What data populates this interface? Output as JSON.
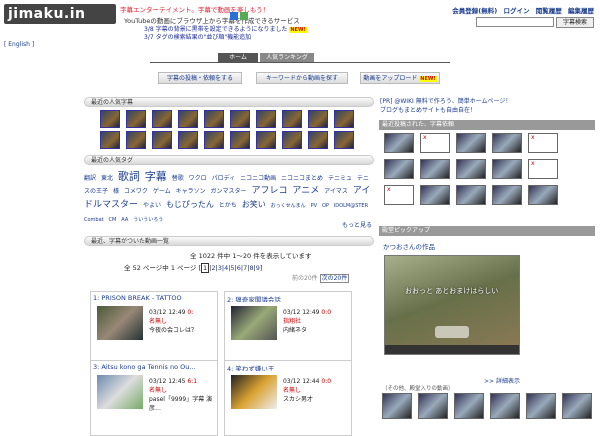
{
  "header": {
    "logo": "jimaku.in",
    "tagline1": "字幕エンターテイメント。字幕で動画を楽しもう！",
    "tagline2": "YouTubeの動画にブラウザ上から字幕を作成できるサービス",
    "news": [
      {
        "text": "3/8 字幕の背景に黒帯を設定できるようになりました",
        "badge": "NEW!"
      },
      {
        "text": "3/7 タグの検索結果の\"並び順\"機能追加",
        "badge": ""
      }
    ],
    "links": [
      "会員登録(無料)",
      "ログイン",
      "閲覧履歴",
      "編集履歴"
    ],
    "search_placeholder": "",
    "search_button": "字幕検索",
    "english": "[ English ]"
  },
  "nav": {
    "home": "ホーム",
    "ranking": "人気ランキング"
  },
  "subnav": [
    {
      "label": "字幕の投稿・依頼をする",
      "badge": ""
    },
    {
      "label": "キーワードから動画を探す",
      "badge": ""
    },
    {
      "label": "動画をアップロード",
      "badge": "NEW!"
    }
  ],
  "sections": {
    "popular_subs": "最近の人気字幕",
    "popular_tags": "最近の人気タグ",
    "recent_videos": "最近、字幕がついた動画一覧"
  },
  "tags": [
    "翻訳",
    "東北",
    "歌詞",
    "字幕",
    "替歌",
    "ワクロ",
    "パロディ",
    "ニコニコ動画",
    "ニコニコまとめ",
    "テニミュ",
    "テニスの王子",
    "様",
    "コメワク",
    "ゲーム",
    "キャラソン",
    "ガンマスター",
    "アフレコ",
    "アニメ",
    "アイマス",
    "アイドルマスター",
    "やよい",
    "もじぴったん",
    "とかち",
    "お笑い",
    "おっくせんまん",
    "PV",
    "OP",
    "IDOLM@STER",
    "Combat",
    "CM",
    "AA",
    "ういういろう"
  ],
  "more_label": "もっと見る",
  "listing": {
    "count_text": "全 1022 件中 1〜20 件を表示しています",
    "pager_prefix": "全 52 ページ中 1 ページ",
    "pages": [
      "1",
      "2",
      "3",
      "4",
      "5",
      "6",
      "7",
      "8",
      "9"
    ],
    "prev": "前の20件",
    "next": "次の20件"
  },
  "videos": [
    {
      "title": "1: PRISON BREAK - TATTOO",
      "date": "03/12 12:49",
      "num": "0:",
      "status": "名無し",
      "note": "今夜の会コレは？"
    },
    {
      "title": "2: 猟奇家閣議会話",
      "date": "03/12 12:49",
      "num": "0:0",
      "status": "指翔社",
      "note": "内緒ネタ"
    },
    {
      "title": "3: Aitsu kono ga Tennis no Ou...",
      "date": "03/12 12:45",
      "num": "6:1",
      "status": "名無し",
      "note": "pasel「9999」字幕 演彦…"
    },
    {
      "title": "4: 笑わず嫌い王",
      "date": "03/12 12:44",
      "num": "0:0",
      "status": "名無し",
      "note": "スカシ男才"
    }
  ],
  "sidebar": {
    "promo1": "[PR] @WIKI 無料で作ろう、簡単ホームページ！",
    "promo2": "ブログもまとめサイトも自由自在！",
    "recent_subs": "最近投稿された、字幕依頼",
    "pickup": "殿堂ピックアップ",
    "pick_author": "かつおさんの作品",
    "video_subtitle": "おおっと あとおまけはらしい",
    "detail": ">> 詳細表示",
    "other": "（その他、殿堂入りの動画）"
  }
}
